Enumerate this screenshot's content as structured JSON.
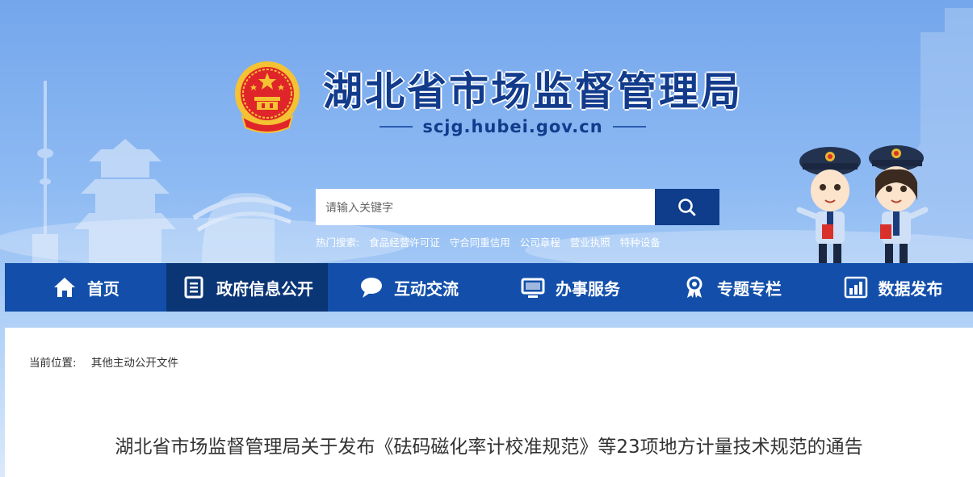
{
  "header": {
    "site_title": "湖北省市场监督管理局",
    "domain": "scjg.hubei.gov.cn"
  },
  "search": {
    "placeholder": "请输入关键字",
    "hot_label": "热门搜索:",
    "hot_items": [
      "食品经营许可证",
      "守合同重信用",
      "公司章程",
      "营业执照",
      "特种设备"
    ]
  },
  "nav": {
    "items": [
      {
        "label": "首页",
        "icon": "home-icon"
      },
      {
        "label": "政府信息公开",
        "icon": "document-list-icon"
      },
      {
        "label": "互动交流",
        "icon": "chat-bubble-icon"
      },
      {
        "label": "办事服务",
        "icon": "monitor-icon"
      },
      {
        "label": "专题专栏",
        "icon": "award-ribbon-icon"
      },
      {
        "label": "数据发布",
        "icon": "bar-chart-icon"
      }
    ],
    "active_index": 1
  },
  "breadcrumb": {
    "label": "当前位置:",
    "current": "其他主动公开文件"
  },
  "article": {
    "title": "湖北省市场监督管理局关于发布《砝码磁化率计校准规范》等23项地方计量技术规范的通告"
  },
  "colors": {
    "nav_bg": "#134faa",
    "nav_active": "#0b3676",
    "title_color": "#123b8c",
    "search_button": "#0f3c8b"
  }
}
